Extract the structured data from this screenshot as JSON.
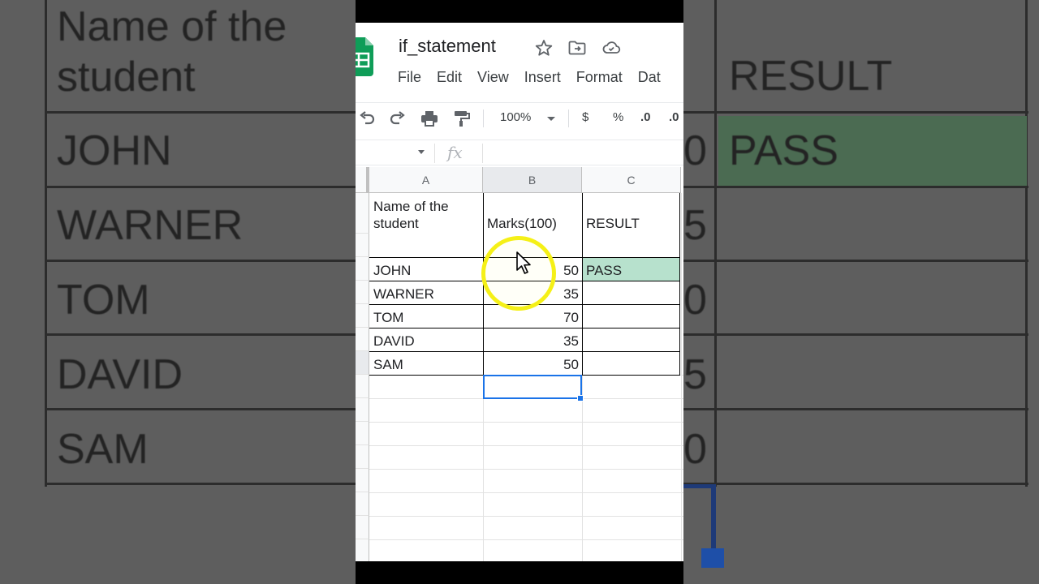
{
  "background": {
    "header_left": "Name of the\nstudent",
    "header_right": "RESULT",
    "names": [
      "JOHN",
      "WARNER",
      "TOM",
      "DAVID",
      "SAM"
    ],
    "marks_partial": [
      "0",
      "5",
      "0",
      "5",
      "0"
    ],
    "result_first": "PASS"
  },
  "document": {
    "title": "if_statement",
    "icons": [
      "star-icon",
      "move-to-folder-icon",
      "cloud-status-icon"
    ]
  },
  "menu": [
    "File",
    "Edit",
    "View",
    "Insert",
    "Format",
    "Dat"
  ],
  "toolbar": {
    "zoom": "100%",
    "currency": "$",
    "percent": "%",
    "decrease_decimal": ".0",
    "increase_decimal": ".0"
  },
  "formula_bar": {
    "fx": "fx",
    "value": ""
  },
  "columns": [
    "A",
    "B",
    "C"
  ],
  "table": {
    "headers": {
      "name": "Name of the\nstudent",
      "marks": "Marks(100)",
      "result": "RESULT"
    },
    "rows": [
      {
        "name": "JOHN",
        "marks": "50",
        "result": "PASS"
      },
      {
        "name": "WARNER",
        "marks": "35",
        "result": ""
      },
      {
        "name": "TOM",
        "marks": "70",
        "result": ""
      },
      {
        "name": "DAVID",
        "marks": "35",
        "result": ""
      },
      {
        "name": "SAM",
        "marks": "50",
        "result": ""
      }
    ]
  },
  "colors": {
    "pass_fill": "#b7e1cd",
    "selection": "#1a73e8",
    "sheets_green": "#0f9d58",
    "highlight_ring": "#f5f017"
  }
}
